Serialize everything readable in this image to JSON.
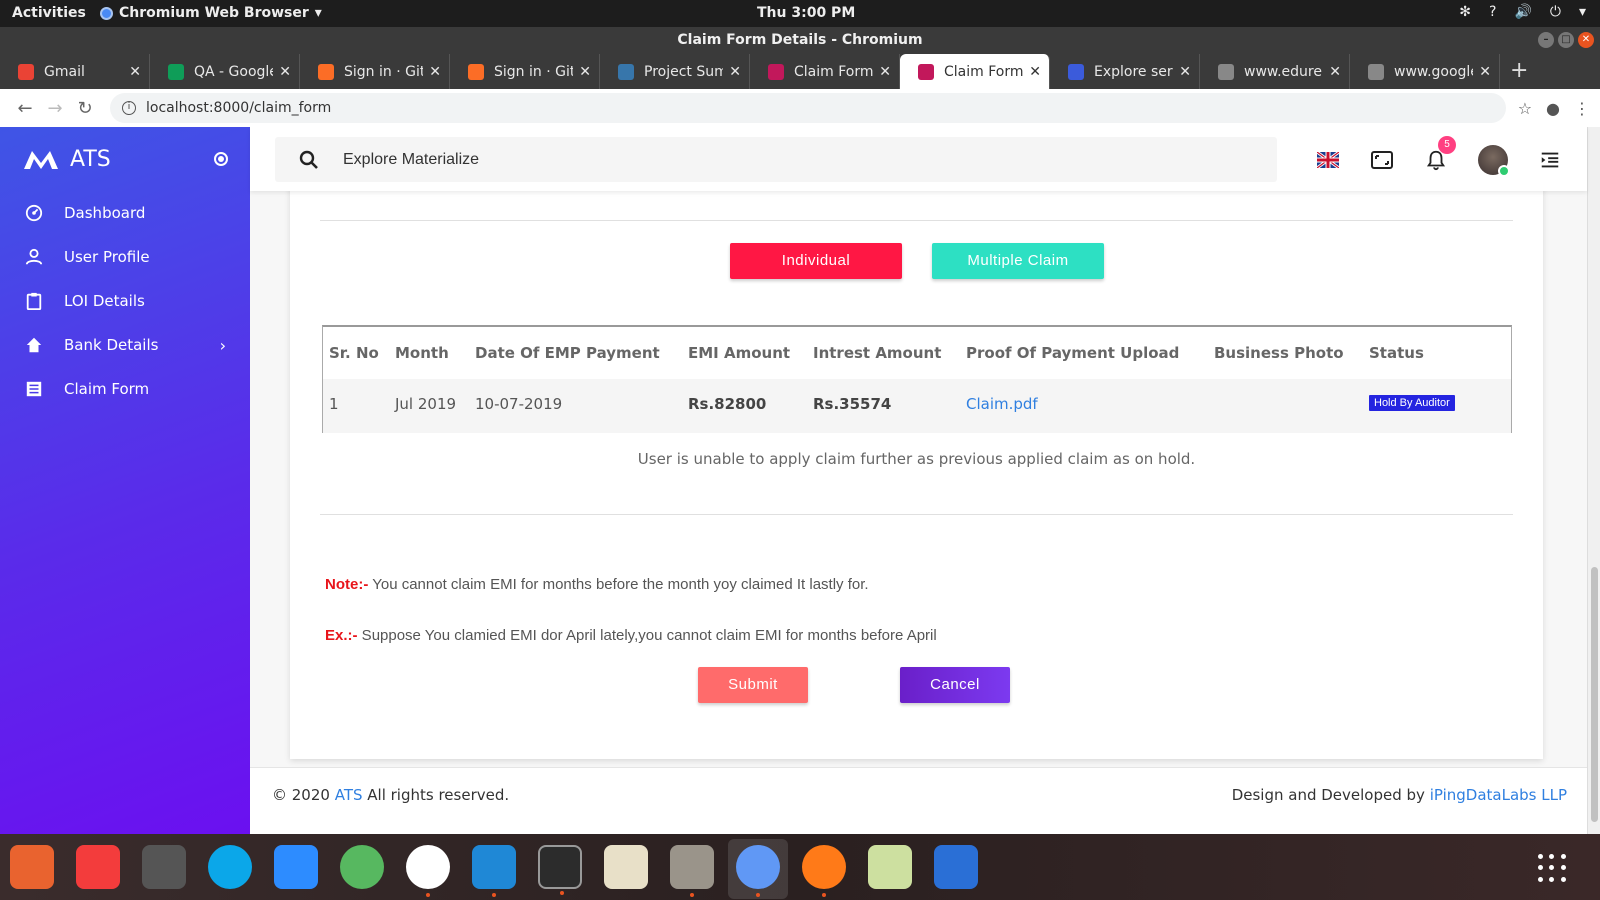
{
  "system": {
    "activities": "Activities",
    "app_menu": "Chromium Web Browser",
    "clock": "Thu  3:00 PM"
  },
  "browser": {
    "window_title": "Claim Form Details - Chromium",
    "tabs": [
      {
        "label": "Gmail",
        "color": "#ea4335"
      },
      {
        "label": "QA - Google",
        "color": "#0f9d58"
      },
      {
        "label": "Sign in · GitL",
        "color": "#fc6d26"
      },
      {
        "label": "Sign in · GitL",
        "color": "#fc6d26"
      },
      {
        "label": "Project Sum",
        "color": "#3776ab"
      },
      {
        "label": "Claim Form D",
        "color": "#c2185b"
      },
      {
        "label": "Claim Form D",
        "color": "#c2185b"
      },
      {
        "label": "Explore serv",
        "color": "#3b5bdb"
      },
      {
        "label": "www.edurek",
        "color": "#888888"
      },
      {
        "label": "www.google",
        "color": "#888888"
      }
    ],
    "active_tab_index": 6,
    "url": "localhost:8000/claim_form"
  },
  "sidebar": {
    "brand": "ATS",
    "items": [
      {
        "label": "Dashboard",
        "icon": "dashboard-icon"
      },
      {
        "label": "User Profile",
        "icon": "person-icon"
      },
      {
        "label": "LOI Details",
        "icon": "clipboard-icon"
      },
      {
        "label": "Bank Details",
        "icon": "home-icon",
        "has_submenu": true
      },
      {
        "label": "Claim Form",
        "icon": "list-icon"
      }
    ]
  },
  "header": {
    "search_placeholder": "Explore Materialize",
    "notification_count": "5"
  },
  "claim": {
    "individual_label": "Individual",
    "multiple_label": "Multiple Claim",
    "table": {
      "headers": [
        "Sr. No",
        "Month",
        "Date Of EMP Payment",
        "EMI Amount",
        "Intrest Amount",
        "Proof Of Payment Upload",
        "Business Photo",
        "Status"
      ],
      "rows": [
        {
          "sr": "1",
          "month": "Jul 2019",
          "date": "10-07-2019",
          "emi": "Rs.82800",
          "interest": "Rs.35574",
          "proof": "Claim.pdf",
          "photo": "",
          "status": "Hold By Auditor"
        }
      ]
    },
    "hold_message": "User is unable to apply claim further as previous applied claim as on hold.",
    "note_label": "Note:-",
    "note_text": " You cannot claim EMI for months before the month yoy claimed It lastly for.",
    "example_label": "Ex.:-",
    "example_text": " Suppose You clamied EMI dor April lately,you cannot claim EMI for months before April",
    "submit_label": "Submit",
    "cancel_label": "Cancel"
  },
  "footer": {
    "copyright_prefix": "© 2020 ",
    "copyright_link": "ATS",
    "copyright_suffix": " All rights reserved.",
    "credit_prefix": "Design and Developed by ",
    "credit_link": "iPingDataLabs LLP"
  },
  "colors": {
    "individual": "#ff1744",
    "multiple": "#2de0c3",
    "submit": "#ff6b6b",
    "cancel": "#6a2ee0",
    "link": "#2f7fe0",
    "status_badge": "#2424e0"
  }
}
